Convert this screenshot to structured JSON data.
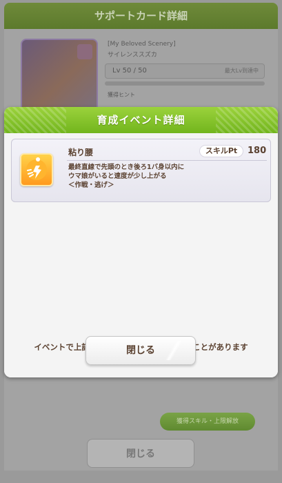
{
  "background": {
    "header_title": "サポートカード詳細",
    "card_title": "[My Beloved Scenery]",
    "card_name": "サイレンススズカ",
    "level_label": "Lv 50 / 50",
    "level_note": "最大Lv到達中",
    "section_label": "獲得ヒント",
    "green_button_label": "獲得スキル・上限解放",
    "close_label": "閉じる"
  },
  "modal": {
    "title": "育成イベント詳細",
    "skill": {
      "icon": "speed-skill-icon",
      "name": "粘り腰",
      "pt_label": "スキルPt",
      "pt_value": "180",
      "description_lines": [
        "最終直線で先頭のとき後ろ1バ身以内に",
        "ウマ娘がいると速度が少し上がる",
        "＜作戦・逃げ＞"
      ]
    },
    "info_text": "イベントで上記スキルのヒントを入手できることがあります",
    "close_label": "閉じる"
  },
  "colors": {
    "header_green": "#8cc832",
    "text_brown": "#5b4231",
    "skill_icon_orange": "#ffa623"
  }
}
